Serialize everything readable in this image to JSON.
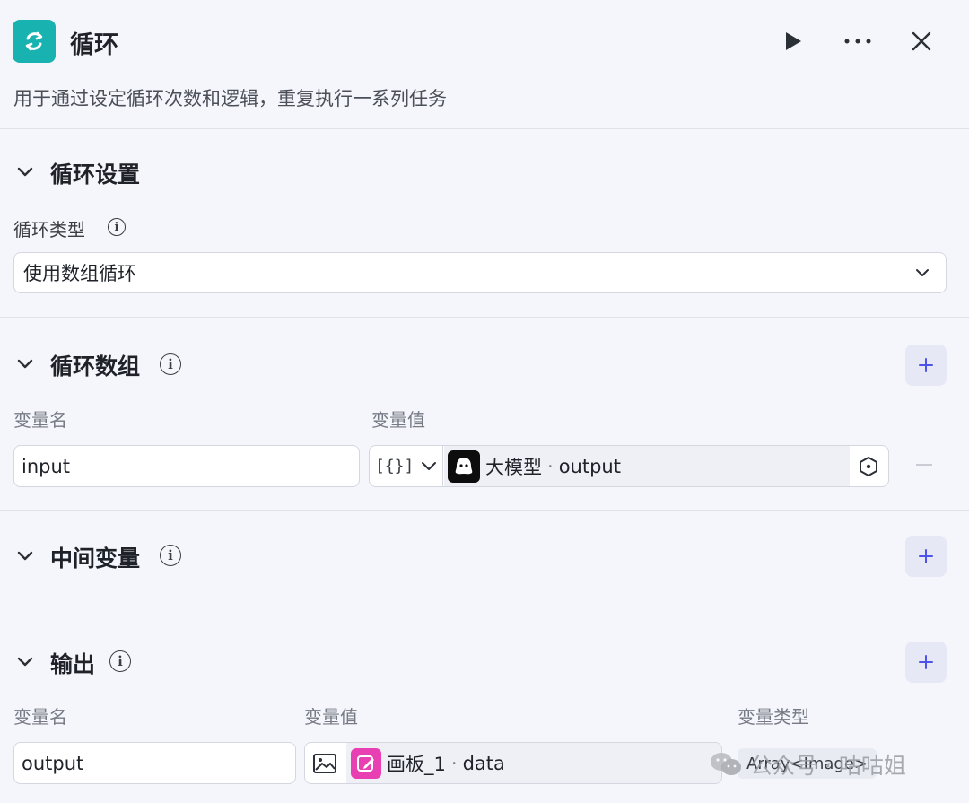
{
  "header": {
    "title": "循环",
    "description": "用于通过设定循环次数和逻辑，重复执行一系列任务",
    "accent_color": "#18b3b0",
    "icons": [
      "loop-icon",
      "play-icon",
      "more-icon",
      "close-icon"
    ]
  },
  "loop_settings": {
    "section_title": "循环设置",
    "type_label": "循环类型",
    "type_value": "使用数组循环"
  },
  "loop_array": {
    "section_title": "循环数组",
    "col_name": "变量名",
    "col_value": "变量值",
    "row": {
      "name": "input",
      "type_glyph": "[{}]",
      "ref_node": "大模型",
      "ref_sep": "·",
      "ref_field": "output"
    }
  },
  "intermediate": {
    "section_title": "中间变量"
  },
  "output": {
    "section_title": "输出",
    "col_name": "变量名",
    "col_value": "变量值",
    "col_type": "变量类型",
    "row": {
      "name": "output",
      "ref_node": "画板_1",
      "ref_sep": "·",
      "ref_field": "data",
      "var_type": "Array<Image>"
    }
  },
  "watermark": "公众号 · 咕咕姐"
}
